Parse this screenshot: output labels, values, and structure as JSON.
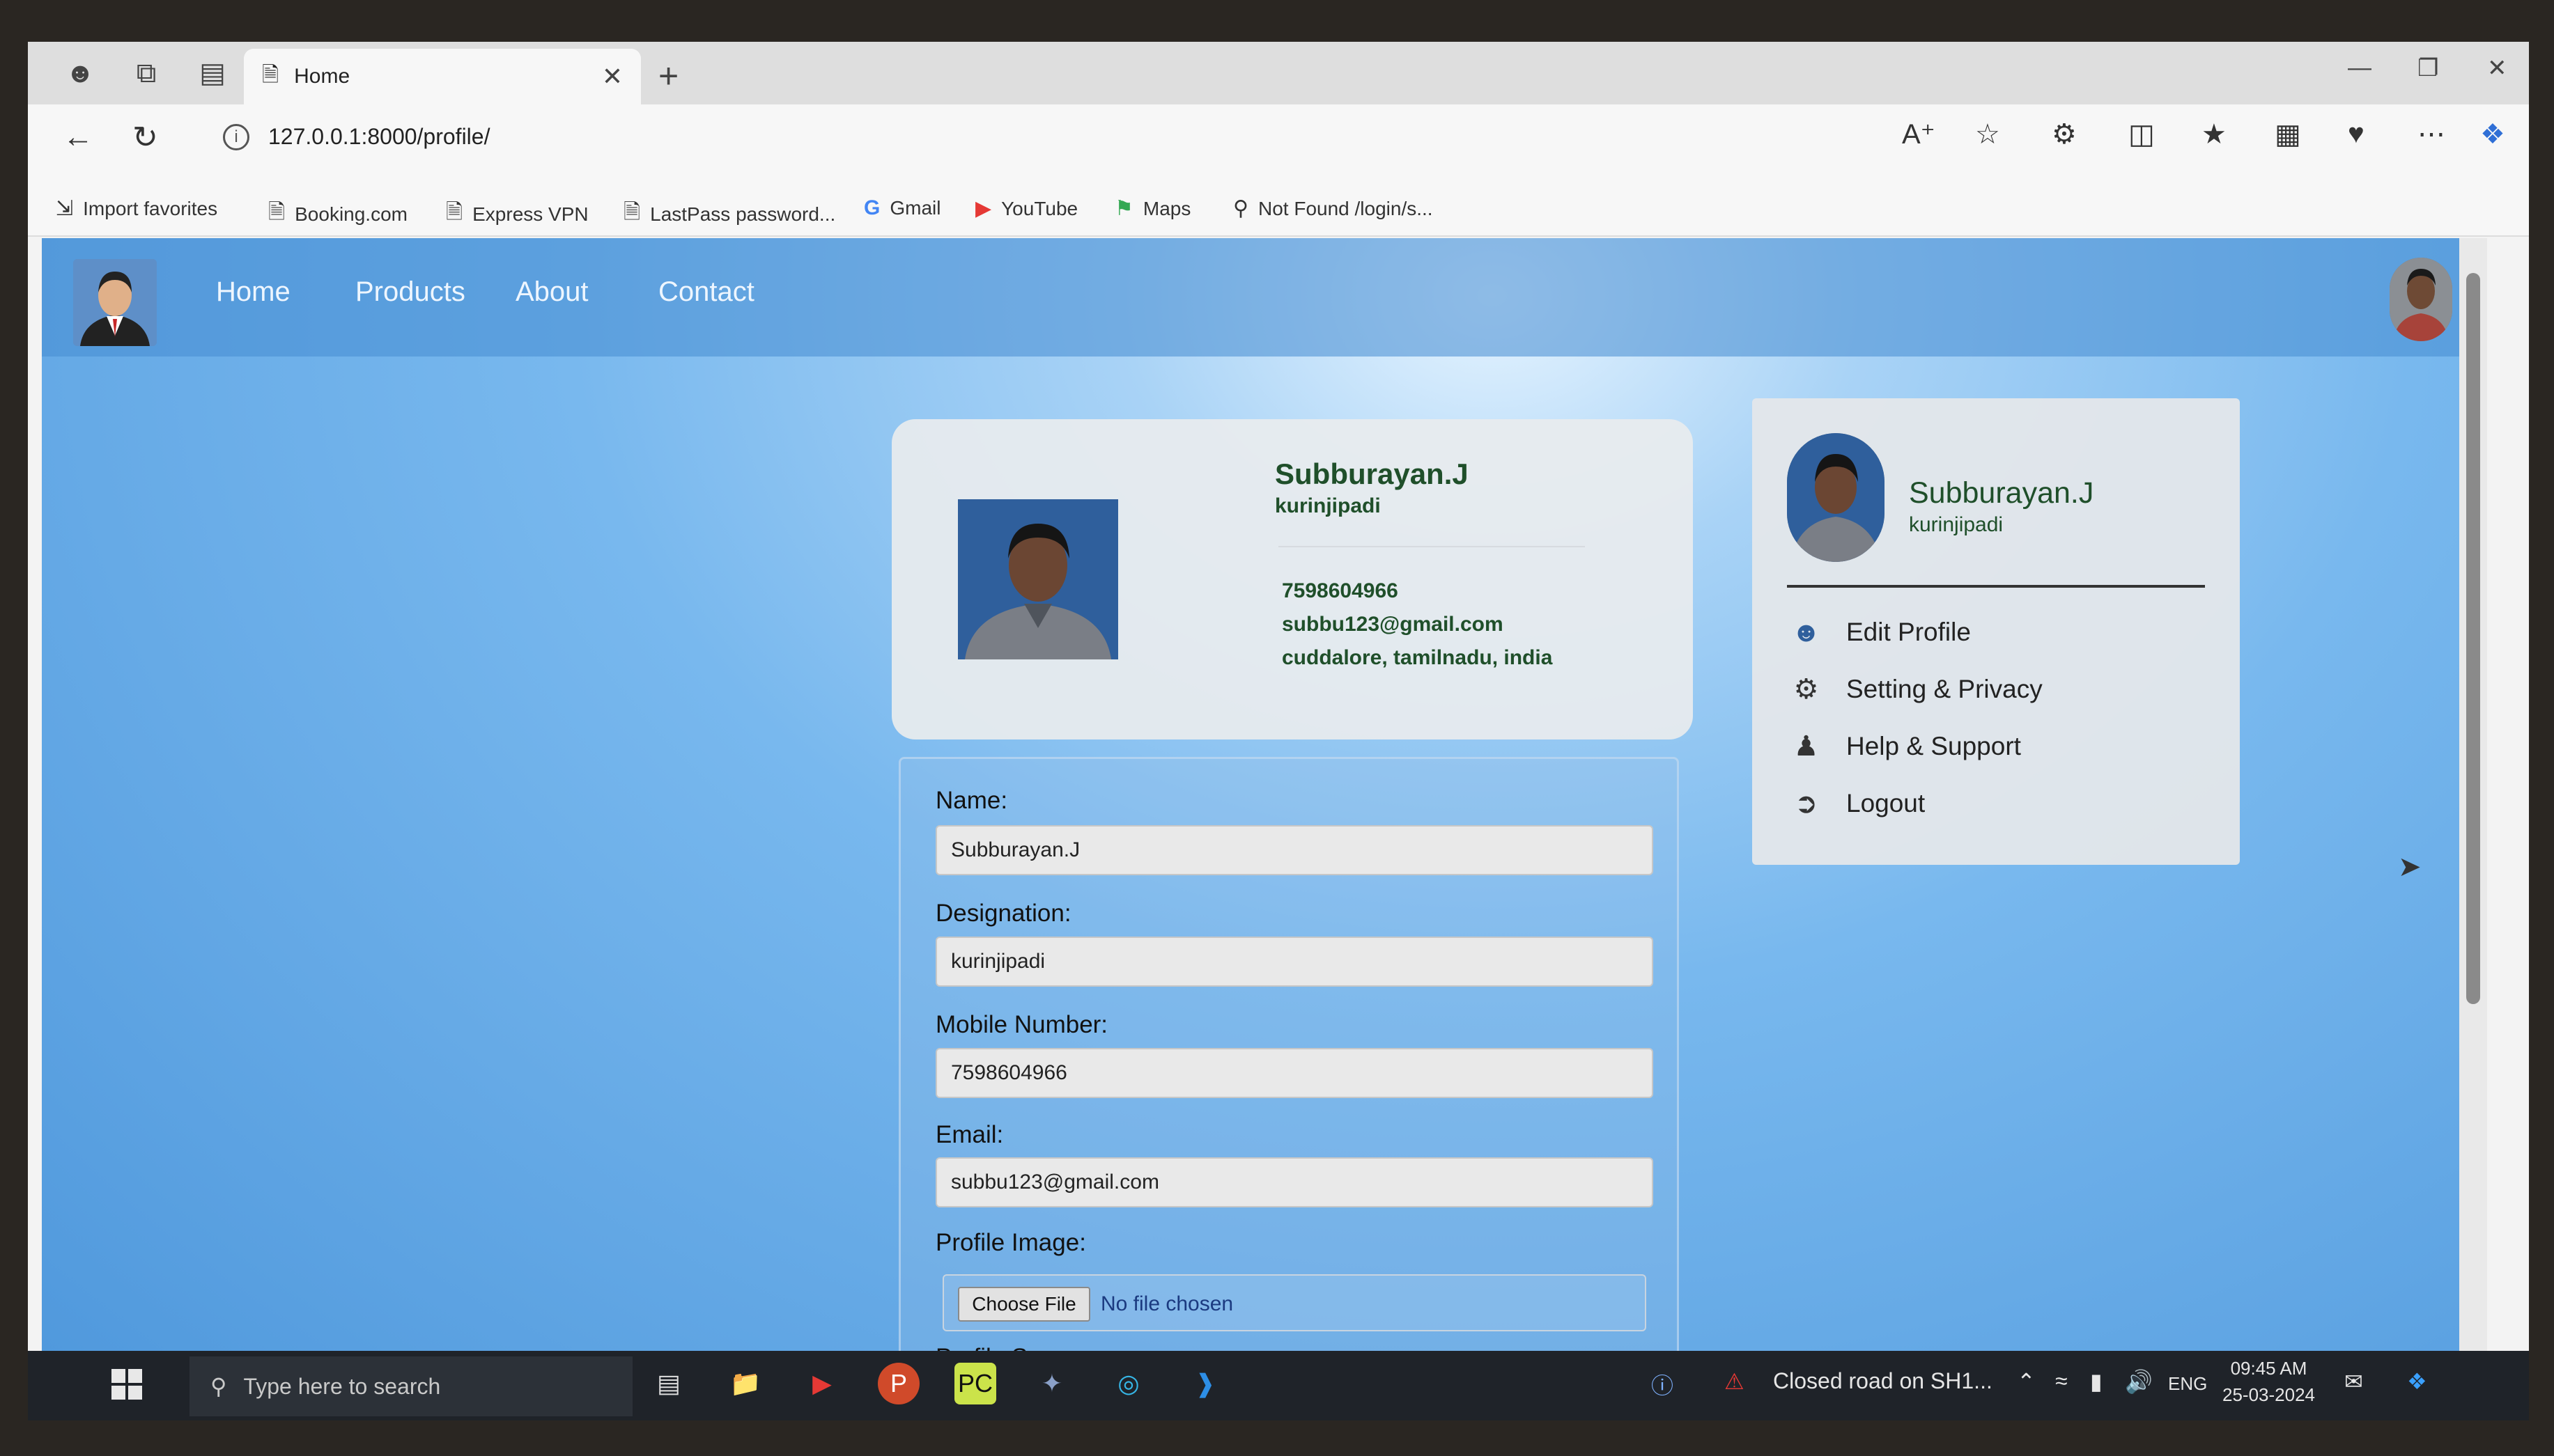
{
  "browser": {
    "tab_title": "Home",
    "url": "127.0.0.1:8000/profile/",
    "favorites": [
      {
        "label": "Import favorites",
        "icon": "import-icon"
      },
      {
        "label": "Booking.com",
        "icon": "page-icon"
      },
      {
        "label": "Express VPN",
        "icon": "page-icon"
      },
      {
        "label": "LastPass password...",
        "icon": "page-icon"
      },
      {
        "label": "Gmail",
        "icon": "google-icon"
      },
      {
        "label": "YouTube",
        "icon": "youtube-icon"
      },
      {
        "label": "Maps",
        "icon": "maps-icon"
      },
      {
        "label": "Not Found /login/s...",
        "icon": "search-icon"
      }
    ]
  },
  "navbar": {
    "links": [
      "Home",
      "Products",
      "About",
      "Contact"
    ]
  },
  "profile_card": {
    "name": "Subburayan.J",
    "designation": "kurinjipadi",
    "mobile": "7598604966",
    "email": "subbu123@gmail.com",
    "address": "cuddalore, tamilnadu, india"
  },
  "form": {
    "name_label": "Name:",
    "name_value": "Subburayan.J",
    "designation_label": "Designation:",
    "designation_value": "kurinjipadi",
    "mobile_label": "Mobile Number:",
    "mobile_value": "7598604966",
    "email_label": "Email:",
    "email_value": "subbu123@gmail.com",
    "image_label": "Profile Image:",
    "choose_file": "Choose File",
    "no_file": "No file chosen",
    "summary_label": "Profile Summary:"
  },
  "dropdown": {
    "name": "Subburayan.J",
    "designation": "kurinjipadi",
    "items": [
      {
        "label": "Edit Profile",
        "icon": "user-icon"
      },
      {
        "label": "Setting & Privacy",
        "icon": "gear-icon"
      },
      {
        "label": "Help & Support",
        "icon": "help-icon"
      },
      {
        "label": "Logout",
        "icon": "logout-icon"
      }
    ]
  },
  "taskbar": {
    "search_placeholder": "Type here to search",
    "notification": "Closed road on SH1...",
    "language": "ENG",
    "time": "09:45 AM",
    "date": "25-03-2024"
  },
  "colors": {
    "accent_text": "#1f4f2a",
    "page_blue": "#78b8ee",
    "taskbar": "#1f2329"
  }
}
